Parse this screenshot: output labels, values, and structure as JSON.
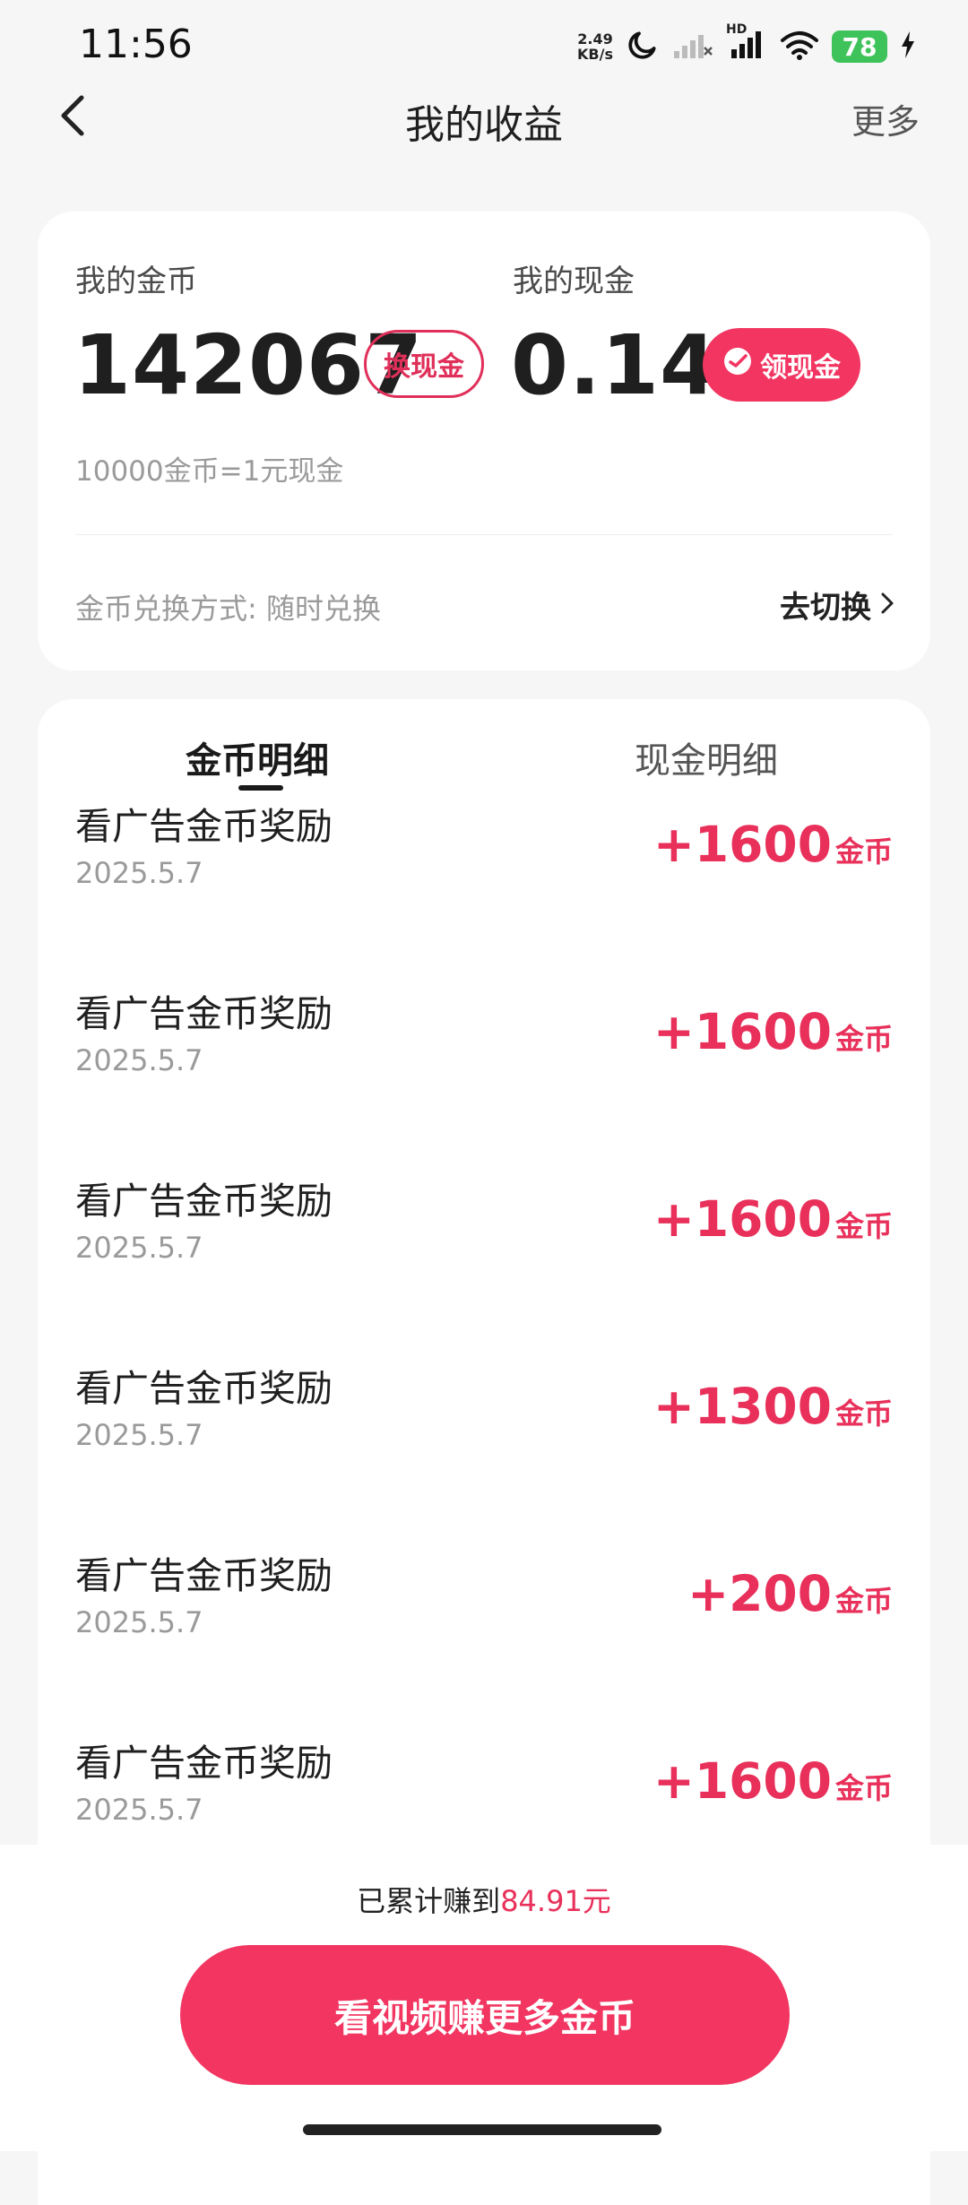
{
  "status_bar": {
    "time": "11:56",
    "net_speed_value": "2.49",
    "net_speed_unit": "KB/s",
    "hd_label": "HD",
    "battery": "78"
  },
  "nav": {
    "title": "我的收益",
    "more": "更多"
  },
  "balance": {
    "coins_label": "我的金币",
    "coins_value": "142067",
    "exchange_button": "换现金",
    "cash_label": "我的现金",
    "cash_value": "0.14",
    "withdraw_button": "领现金",
    "rate_text": "10000金币=1元现金",
    "method_text": "金币兑换方式: 随时兑换",
    "switch_link": "去切换"
  },
  "tabs": [
    {
      "label": "金币明细",
      "active": true
    },
    {
      "label": "现金明细",
      "active": false
    }
  ],
  "records": [
    {
      "title": "看广告金币奖励",
      "date": "2025.5.7",
      "amount": "+1600",
      "unit": "金币"
    },
    {
      "title": "看广告金币奖励",
      "date": "2025.5.7",
      "amount": "+1600",
      "unit": "金币"
    },
    {
      "title": "看广告金币奖励",
      "date": "2025.5.7",
      "amount": "+1600",
      "unit": "金币"
    },
    {
      "title": "看广告金币奖励",
      "date": "2025.5.7",
      "amount": "+1300",
      "unit": "金币"
    },
    {
      "title": "看广告金币奖励",
      "date": "2025.5.7",
      "amount": "+200",
      "unit": "金币"
    },
    {
      "title": "看广告金币奖励",
      "date": "2025.5.7",
      "amount": "+1600",
      "unit": "金币"
    }
  ],
  "footer": {
    "total_prefix": "已累计赚到",
    "total_value": "84.91元",
    "cta": "看视频赚更多金币"
  },
  "colors": {
    "accent": "#f23561",
    "amount": "#e8305a",
    "battery": "#3ec35a"
  }
}
